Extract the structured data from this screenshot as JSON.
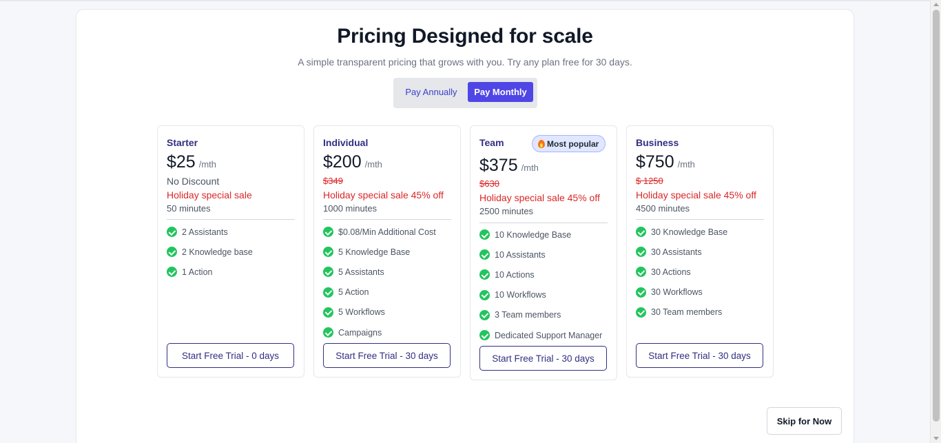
{
  "header": {
    "title": "Pricing Designed for scale",
    "subtitle": "A simple transparent pricing that grows with you. Try any plan free for 30 days."
  },
  "billing_toggle": {
    "annual_label": "Pay Annually",
    "monthly_label": "Pay Monthly",
    "selected": "monthly"
  },
  "plans": [
    {
      "name": "Starter",
      "price": "$25",
      "period": "/mth",
      "discount_note": "No Discount",
      "sale_label": "Holiday special sale",
      "minutes": "50 minutes",
      "features": [
        "2 Assistants",
        "2 Knowledge base",
        "1 Action"
      ],
      "cta": "Start Free Trial - 0 days"
    },
    {
      "name": "Individual",
      "price": "$200",
      "period": "/mth",
      "old_price": "$349",
      "sale_label": "Holiday special sale 45% off",
      "minutes": "1000 minutes",
      "features": [
        "$0.08/Min Additional Cost",
        "5 Knowledge Base",
        "5 Assistants",
        "5 Action",
        "5 Workflows",
        "Campaigns"
      ],
      "cta": "Start Free Trial - 30 days"
    },
    {
      "name": "Team",
      "badge": "Most popular",
      "badge_icon": "flame-icon",
      "price": "$375",
      "period": "/mth",
      "old_price": "$630",
      "sale_label": "Holiday special sale 45% off",
      "minutes": "2500 minutes",
      "features": [
        "10 Knowledge Base",
        "10 Assistants",
        "10 Actions",
        "10 Workflows",
        "3 Team members",
        "Dedicated Support Manager"
      ],
      "cta": "Start Free Trial - 30 days"
    },
    {
      "name": "Business",
      "price": "$750",
      "period": "/mth",
      "old_price": "$ 1250",
      "sale_label": "Holiday special sale 45% off",
      "minutes": "4500 minutes",
      "features": [
        "30 Knowledge Base",
        "30 Assistants",
        "30 Actions",
        "30 Workflows",
        "30 Team members"
      ],
      "cta": "Start Free Trial - 30 days"
    }
  ],
  "footer": {
    "skip_label": "Skip for Now"
  },
  "colors": {
    "accent": "#4f46e5",
    "plan_name": "#312e81",
    "sale_red": "#dc2626",
    "check_green": "#22c55e"
  }
}
